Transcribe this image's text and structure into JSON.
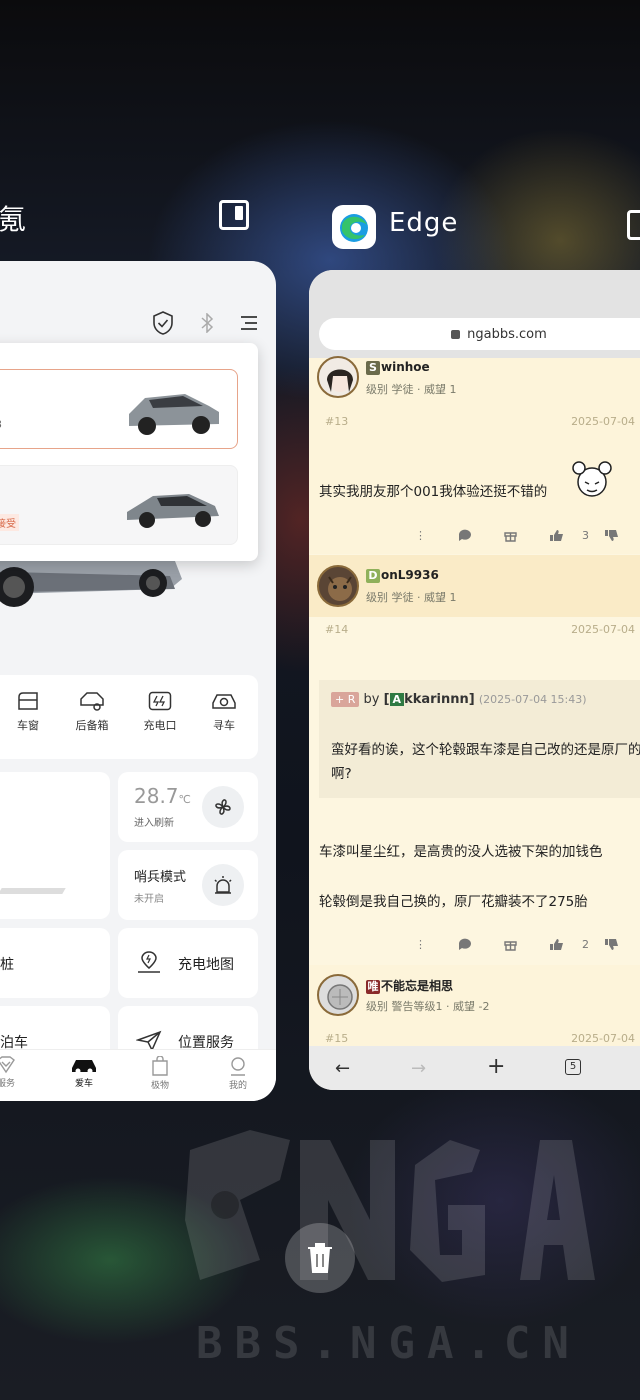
{
  "left_app": {
    "title": "氪"
  },
  "zeekr": {
    "selected_car_sub": "3",
    "alt_car_label": "|",
    "alt_car_tag": "接受",
    "controls": [
      "车窗",
      "后备箱",
      "充电口",
      "寻车"
    ],
    "temperature": {
      "value": "28.7",
      "unit": "℃",
      "sub": "进入刷新"
    },
    "guard_mode": {
      "title": "哨兵模式",
      "status": "未开启"
    },
    "charging_pile": "桩",
    "charging_map": "充电地图",
    "parking": "泊车",
    "location_service": "位置服务",
    "tabs": [
      "服务",
      "爱车",
      "极物",
      "我的"
    ]
  },
  "right_app": {
    "title": "Edge"
  },
  "edge": {
    "url": "ngabbs.com",
    "tab_count": "5"
  },
  "posts": [
    {
      "initial": "S",
      "initial_color": "#6b6b4b",
      "username_rest": "winhoe",
      "level": "级别 学徒 · 威望 1",
      "floor": "#13",
      "date": "2025-07-04",
      "text": "其实我朋友那个001我体验还挺不错的",
      "likes": "3"
    },
    {
      "initial": "D",
      "initial_color": "#8fb05a",
      "username_rest": "onL9936",
      "level": "级别 学徒 · 威望 1",
      "floor": "#14",
      "date": "2025-07-04",
      "quote": {
        "tag": "+ R",
        "by": "by",
        "quoted_user_bracket": "[",
        "quoted_initial": "A",
        "quoted_user_rest": "kkarinnn]",
        "quoted_date": "(2025-07-04 15:43)",
        "text": "蛮好看的诶，这个轮毂跟车漆是自己改的还是原厂的啊?"
      },
      "text_1": "车漆叫星尘红，是高贵的没人选被下架的加钱色",
      "text_2": "轮毂倒是我自己换的，原厂花瓣装不了275胎",
      "likes": "2"
    },
    {
      "initial": "唯",
      "initial_color": "#8a2a2a",
      "username_rest": "不能忘是相思",
      "level": "级别 警告等级1 · 威望 -2",
      "floor": "#15",
      "date": "2025-07-04"
    }
  ],
  "watermark": {
    "text": "BBS.NGA.CN",
    "logo": "NGA"
  },
  "colors": {
    "accent_orange": "#e7a48a",
    "nga_bg": "#fdf6e0"
  }
}
